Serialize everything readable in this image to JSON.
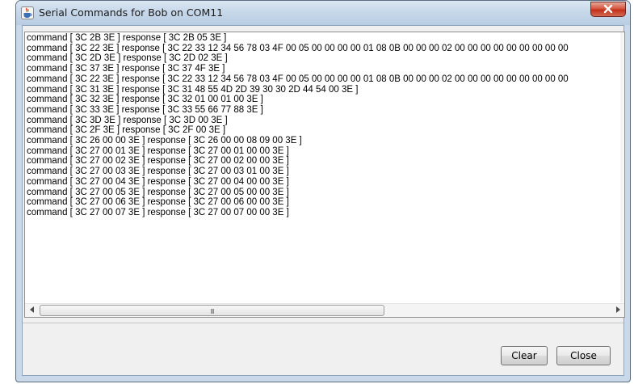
{
  "window": {
    "title": "Serial Commands for Bob on COM11",
    "close_icon": "close-x-icon",
    "app_icon": "java-cup-icon"
  },
  "log": {
    "lines": [
      "command [ 3C 2B 3E ] response [ 3C 2B 05 3E ]",
      "command [ 3C 22 3E ] response [ 3C 22 33 12 34 56 78 03 4F 00 05 00 00 00 00 01 08 0B 00 00 00 02 00 00 00 00 00 00 00 00 00",
      "command [ 3C 2D 3E ] response [ 3C 2D 02 3E ]",
      "command [ 3C 37 3E ] response [ 3C 37 4F 3E ]",
      "command [ 3C 22 3E ] response [ 3C 22 33 12 34 56 78 03 4F 00 05 00 00 00 00 01 08 0B 00 00 00 02 00 00 00 00 00 00 00 00 00",
      "command [ 3C 31 3E ] response [ 3C 31 48 55 4D 2D 39 30 30 2D 44 54 00 3E ]",
      "command [ 3C 32 3E ] response [ 3C 32 01 00 01 00 3E ]",
      "command [ 3C 33 3E ] response [ 3C 33 55 66 77 88 3E ]",
      "command [ 3C 3D 3E ] response [ 3C 3D 00 3E ]",
      "command [ 3C 2F 3E ] response [ 3C 2F 00 3E ]",
      "command [ 3C 26 00 00 3E ] response [ 3C 26 00 00 08 09 00 3E ]",
      "command [ 3C 27 00 01 3E ] response [ 3C 27 00 01 00 00 3E ]",
      "command [ 3C 27 00 02 3E ] response [ 3C 27 00 02 00 00 3E ]",
      "command [ 3C 27 00 03 3E ] response [ 3C 27 00 03 01 00 3E ]",
      "command [ 3C 27 00 04 3E ] response [ 3C 27 00 04 00 00 3E ]",
      "command [ 3C 27 00 05 3E ] response [ 3C 27 00 05 00 00 3E ]",
      "command [ 3C 27 00 06 3E ] response [ 3C 27 00 06 00 00 3E ]",
      "command [ 3C 27 00 07 3E ] response [ 3C 27 00 07 00 00 3E ]"
    ]
  },
  "scrollbar": {
    "grip": "III",
    "left_icon": "chevron-left-icon",
    "right_icon": "chevron-right-icon"
  },
  "buttons": {
    "clear_label": "Clear",
    "close_label": "Close"
  },
  "colors": {
    "frame": "#c9d9ea",
    "close_button": "#c1301a",
    "client_background": "#f0f0f0"
  }
}
